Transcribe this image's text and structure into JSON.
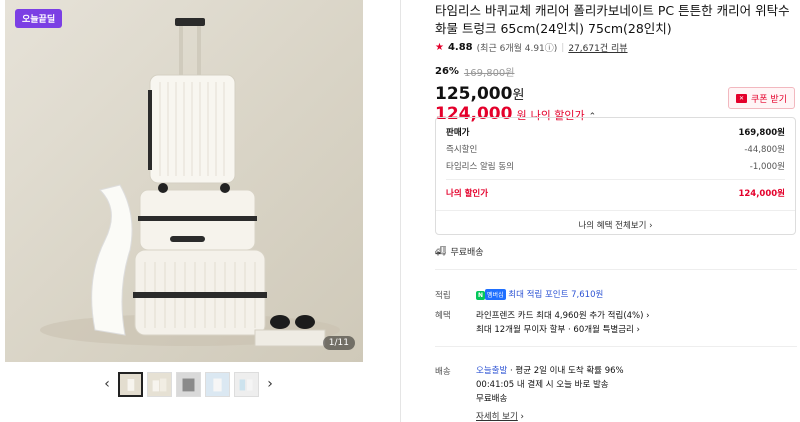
{
  "gallery": {
    "badge": "오늘끝딜",
    "counter": "1/11",
    "prev_icon": "chevron-left-icon",
    "next_icon": "chevron-right-icon",
    "thumbnail_count": 5
  },
  "product": {
    "title": "타임리스 바퀴교체 캐리어 폴리카보네이트 PC 튼튼한 캐리어 위탁수화물 트렁크 65cm(24인치) 75cm(28인치)",
    "rating": "4.88",
    "rating_recent": "(최근 6개월 4.91",
    "reviews": "27,671건 리뷰"
  },
  "price": {
    "discount_pct": "26%",
    "original": "169,800원",
    "sale": "125,000",
    "won": "원",
    "my_price": "124,000",
    "my_price_won": "원",
    "my_price_label": "나의 할인가",
    "coupon_label": "쿠폰 받기",
    "accent": "#e4002b"
  },
  "breakdown": {
    "rows": [
      {
        "label": "판매가",
        "value": "169,800원"
      },
      {
        "label": "즉시할인",
        "value": "-44,800원"
      },
      {
        "label": "타임리스 알림 동의",
        "value": "-1,000원"
      }
    ],
    "total_label": "나의 할인가",
    "total_value": "124,000원",
    "view_all": "나의 혜택 전체보기"
  },
  "shipping_free": "무료배송",
  "points": {
    "label": "적립",
    "badge_n": "N",
    "badge_pay": "멤버십",
    "text": "최대 적립 포인트 7,610원"
  },
  "benefits": {
    "label": "혜택",
    "line1": "라인프렌즈 카드 최대 4,960원 추가 적립(4%)",
    "line2": "최대 12개월 무이자 할부 · 60개월 특별금리"
  },
  "delivery": {
    "label": "배송",
    "today": "오늘출발",
    "today_desc": "평균 2일 이내 도착 확률 96%",
    "countdown": "00:41:05",
    "countdown_desc": "내 결제 시 오늘 바로 발송",
    "free": "무료배송",
    "detail": "자세히 보기"
  }
}
